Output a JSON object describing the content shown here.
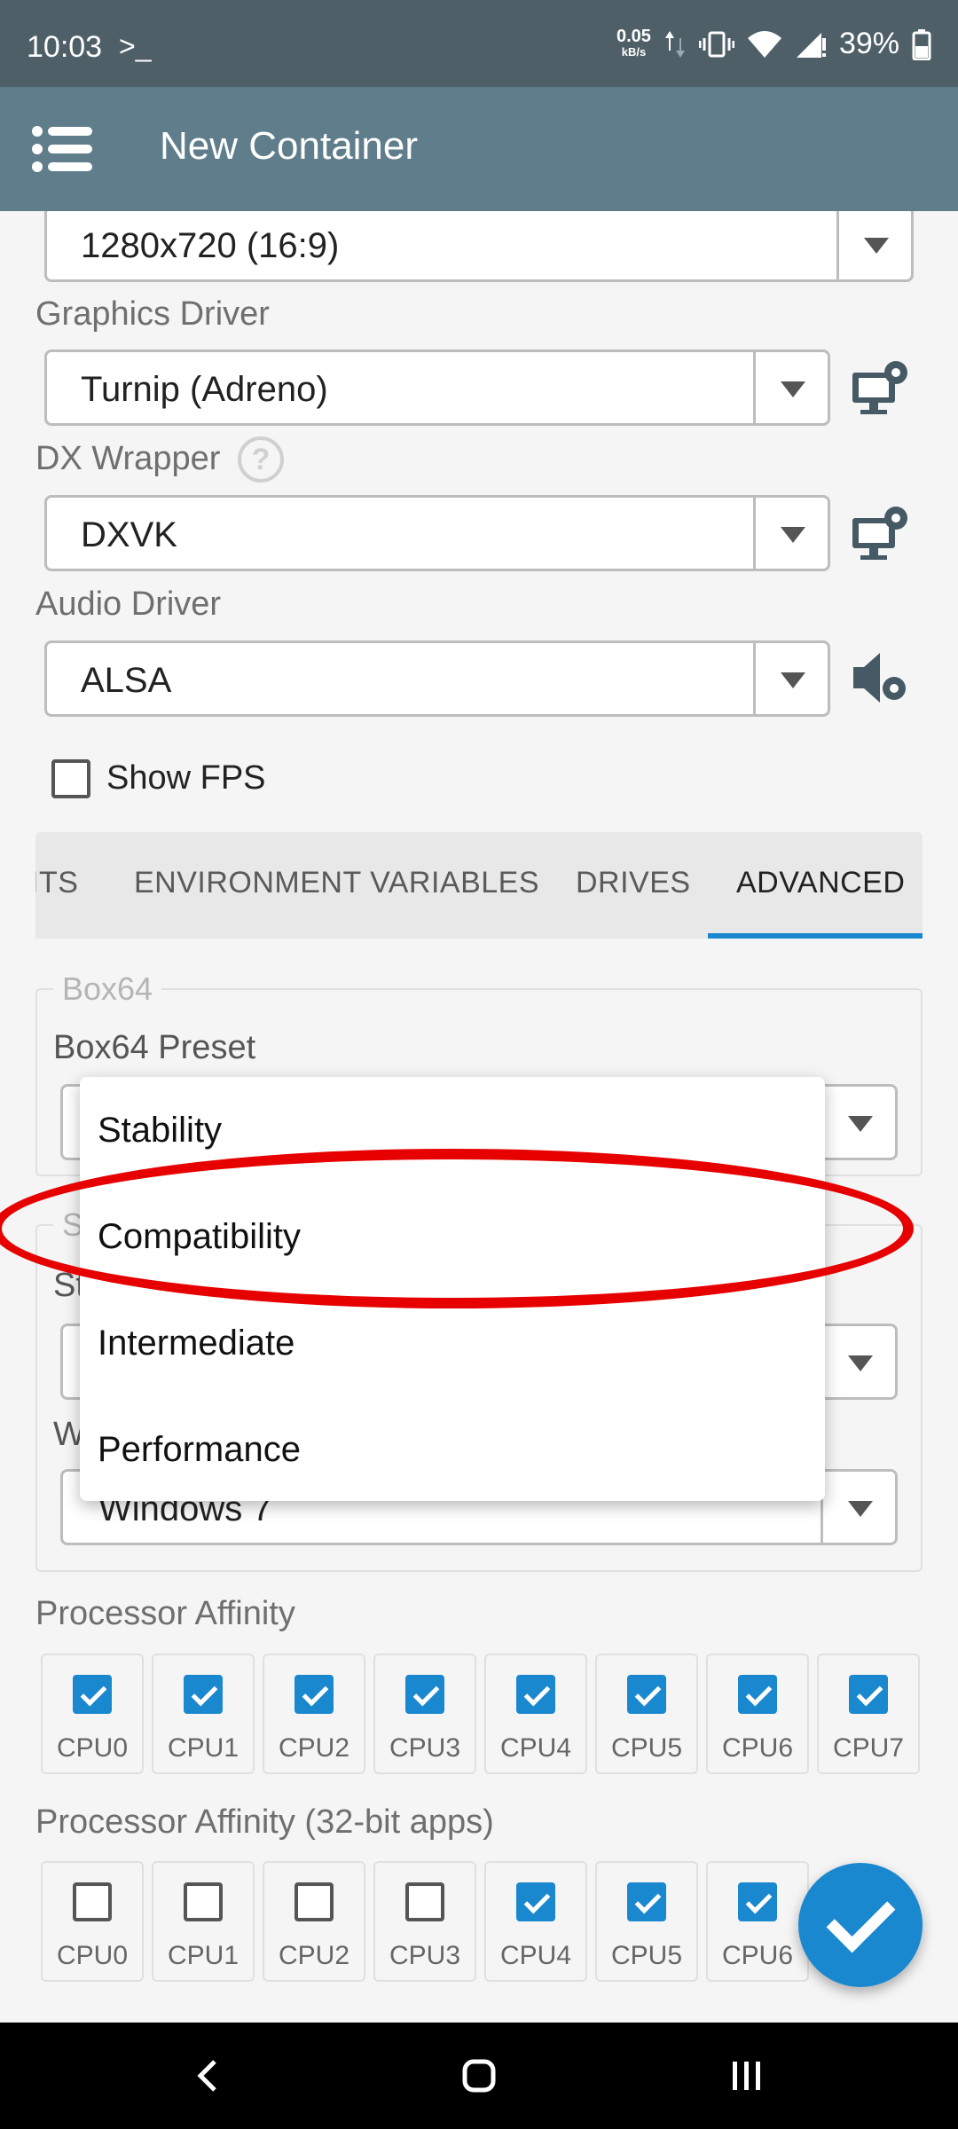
{
  "status_bar": {
    "time": "10:03",
    "terminal": ">_",
    "net_speed": "0.05",
    "net_unit": "kB/s",
    "battery": "39%"
  },
  "app_bar": {
    "title": "New Container"
  },
  "fields": {
    "resolution_value": "1280x720 (16:9)",
    "graphics_driver_label": "Graphics Driver",
    "graphics_driver_value": "Turnip (Adreno)",
    "dx_wrapper_label": "DX Wrapper",
    "dx_wrapper_help": "?",
    "dx_wrapper_value": "DXVK",
    "audio_driver_label": "Audio Driver",
    "audio_driver_value": "ALSA",
    "show_fps_label": "Show FPS"
  },
  "tabs": [
    "ITS",
    "ENVIRONMENT VARIABLES",
    "DRIVES",
    "ADVANCED"
  ],
  "box64": {
    "group_label": "Box64",
    "preset_label": "Box64 Preset",
    "group2_fragment": "S",
    "field_label_fragment": "St",
    "win_label_fragment": "W",
    "windows_value": "Windows 7"
  },
  "dropdown": {
    "options": [
      "Stability",
      "Compatibility",
      "Intermediate",
      "Performance"
    ]
  },
  "affinity": {
    "label": "Processor Affinity",
    "cpus": [
      "CPU0",
      "CPU1",
      "CPU2",
      "CPU3",
      "CPU4",
      "CPU5",
      "CPU6",
      "CPU7"
    ],
    "checked": [
      true,
      true,
      true,
      true,
      true,
      true,
      true,
      true
    ]
  },
  "affinity32": {
    "label": "Processor Affinity (32-bit apps)",
    "cpus": [
      "CPU0",
      "CPU1",
      "CPU2",
      "CPU3",
      "CPU4",
      "CPU5",
      "CPU6"
    ],
    "checked": [
      false,
      false,
      false,
      false,
      true,
      true,
      true
    ]
  },
  "colors": {
    "accent": "#1a88cf",
    "appbar": "#607d8b",
    "highlight": "#e60000"
  }
}
